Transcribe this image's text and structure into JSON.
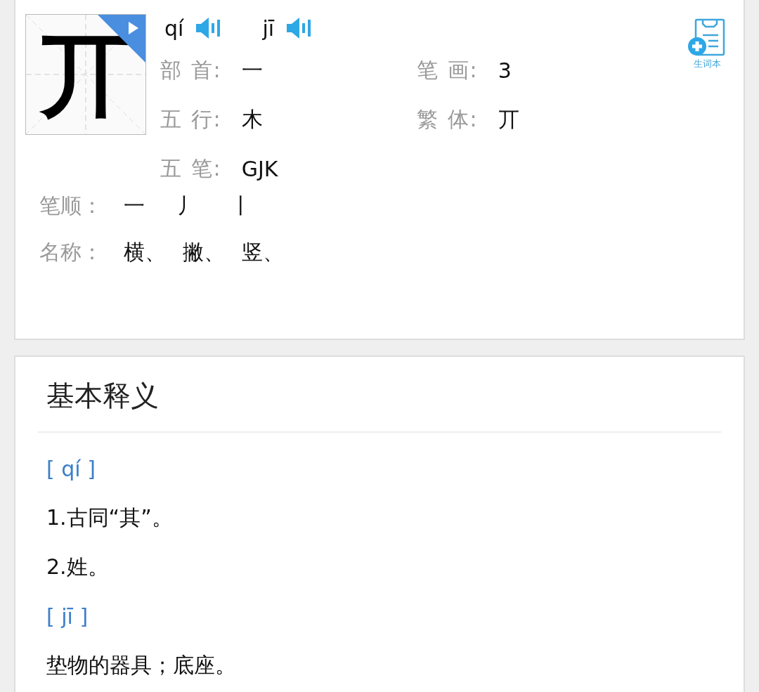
{
  "character": "丌",
  "pronunciations": [
    {
      "pinyin": "qí"
    },
    {
      "pinyin": "jī"
    }
  ],
  "vocab_button": {
    "label": "生词本"
  },
  "info": [
    {
      "label": "部 首:",
      "value": "一"
    },
    {
      "label": "笔 画:",
      "value": "3"
    },
    {
      "label": "五 行:",
      "value": "木"
    },
    {
      "label": "繁 体:",
      "value": "丌"
    },
    {
      "label": "五 笔:",
      "value": "GJK"
    }
  ],
  "strokes": {
    "label": "笔顺：",
    "items": [
      "一",
      "丿",
      "丨"
    ]
  },
  "stroke_names": {
    "label": "名称：",
    "items": [
      "横、",
      "撇、",
      "竖、"
    ]
  },
  "definitions": {
    "title": "基本释义",
    "groups": [
      {
        "pinyin": "[ qí ]",
        "lines": [
          "1.古同“其”。",
          "2.姓。"
        ]
      },
      {
        "pinyin": "[ jī ]",
        "lines": [
          "垫物的器具；底座。"
        ]
      }
    ]
  }
}
